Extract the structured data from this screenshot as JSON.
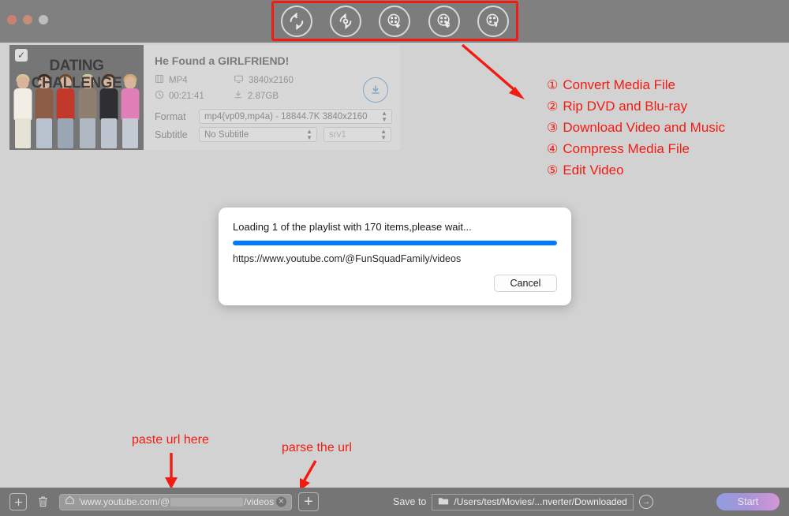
{
  "window": {
    "traffic_lights": [
      "close",
      "minimize",
      "maximize"
    ]
  },
  "toolbar": {
    "items": [
      {
        "name": "converter",
        "icon": "convert-icon"
      },
      {
        "name": "ripper",
        "icon": "disc-ripper-icon"
      },
      {
        "name": "downloader",
        "icon": "reel-download-icon"
      },
      {
        "name": "compressor",
        "icon": "reel-compress-icon"
      },
      {
        "name": "editor",
        "icon": "reel-edit-icon"
      }
    ],
    "highlight_color": "#f21b12"
  },
  "video_card": {
    "thumbnail_title": "DATING CHALLENGE",
    "checked": true,
    "title": "He Found a GIRLFRIEND!",
    "meta": [
      {
        "icon": "film-icon",
        "value": "MP4"
      },
      {
        "icon": "monitor-icon",
        "value": "3840x2160"
      },
      {
        "icon": "clock-icon",
        "value": "00:21:41"
      },
      {
        "icon": "download-icon",
        "value": "2.87GB"
      }
    ],
    "format_label": "Format",
    "format_value": "mp4(vp09,mp4a) - 18844.7K 3840x2160",
    "subtitle_label": "Subtitle",
    "subtitle_value": "No Subtitle",
    "subtitle_format_value": "srv1",
    "download_icon": "download-circle-icon"
  },
  "annotations": {
    "features": [
      {
        "num": "①",
        "label": "Convert Media File"
      },
      {
        "num": "②",
        "label": "Rip DVD and Blu-ray"
      },
      {
        "num": "③",
        "label": "Download Video and Music"
      },
      {
        "num": "④",
        "label": "Compress Media File"
      },
      {
        "num": "⑤",
        "label": "Edit Video"
      }
    ],
    "paste_url": "paste url here",
    "parse_url": "parse the url",
    "color": "#f21b12"
  },
  "modal": {
    "title": "Loading 1 of the playlist with 170 items,please wait...",
    "progress_percent": 100,
    "progress_color": "#007aff",
    "url": "https://www.youtube.com/@FunSquadFamily/videos",
    "cancel_label": "Cancel"
  },
  "bottom_bar": {
    "add_icon": "plus-box-icon",
    "delete_icon": "trash-icon",
    "url_home_icon": "home-icon",
    "url_prefix": "'www.youtube.com/@",
    "url_suffix": "/videos",
    "url_clear_icon": "clear-circle-icon",
    "parse_icon": "plus-icon",
    "parse_symbol": "+",
    "save_to_label": "Save to",
    "save_to_path": "/Users/test/Movies/...nverter/Downloaded",
    "folder_icon": "folder-icon",
    "go_icon": "arrow-right-circle-icon",
    "go_symbol": "→",
    "start_label": "Start"
  }
}
